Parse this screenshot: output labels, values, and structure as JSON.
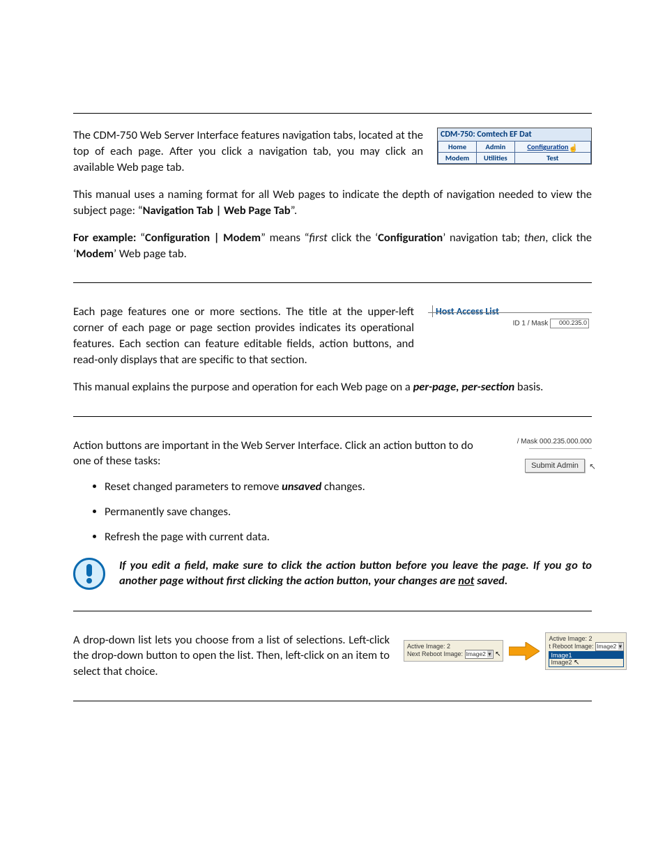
{
  "navfig": {
    "title": "CDM-750: Comtech EF Dat",
    "row1": [
      "Home",
      "Admin",
      "Configuration"
    ],
    "row2": [
      "Modem",
      "Utilities",
      "Test"
    ]
  },
  "section1": {
    "intro": "The CDM-750 Web Server Interface features navigation tabs, located at the top of each page. After you click a navigation tab, you may click an available Web page tab.",
    "explain_pre": "This manual uses a naming format for all Web pages to indicate the depth of navigation needed to view the subject page: “",
    "explain_bold": "Navigation Tab | Web Page Tab",
    "explain_post": "”.",
    "example_pre": "For example:",
    "example_q1": " “",
    "example_bold1": "Configuration | Modem",
    "example_mid": "” means “",
    "example_first": "first",
    "example_post_first": " click the ‘",
    "example_conf": "Configuration",
    "example_postconf": "’ navigation tab; ",
    "example_then": "then",
    "example_postthen": ", click the ‘",
    "example_modem": "Modem",
    "example_tail": "’ Web page tab."
  },
  "section2": {
    "intro": "Each page features one or more sections. The title at the upper-left corner of each page or page section provides indicates its operational features. Each section can feature editable fields, action buttons, and read-only displays that are specific to that section.",
    "fig_legend": "Host Access List",
    "fig_sub_pre": "ID 1 / Mask ",
    "fig_sub_val": "000.235.0",
    "p2_pre": "This manual explains the purpose and operation for each Web page on a ",
    "p2_em": "per-page, per-section",
    "p2_post": " basis."
  },
  "section3": {
    "intro": "Action buttons are important in the Web Server Interface. Click an action button to do one of these tasks:",
    "mask_top": "/ Mask 000.235.000.000",
    "submit_btn": "Submit Admin",
    "b1_pre": "Reset changed parameters to remove ",
    "b1_em": "unsaved",
    "b1_post": " changes.",
    "b2": "Permanently save changes.",
    "b3": "Refresh the page with current data.",
    "caution_l1": "If you edit a field, make sure to click the action button before you leave the page. If you go to another page without first clicking the action button, your changes are ",
    "caution_not": "not",
    "caution_saved": " saved."
  },
  "section4": {
    "intro": "A drop-down list lets you choose from a list of selections. Left-click the drop-down button to open the list. Then, left-click on an item to select that choice.",
    "active_label": "Active Image:",
    "active_value": "2",
    "reboot_label": "Next Reboot Image:",
    "select_shown": "Image2",
    "opt1": "Image1",
    "opt2": "Image2",
    "reboot_label_trunc": "t Reboot Image:"
  }
}
